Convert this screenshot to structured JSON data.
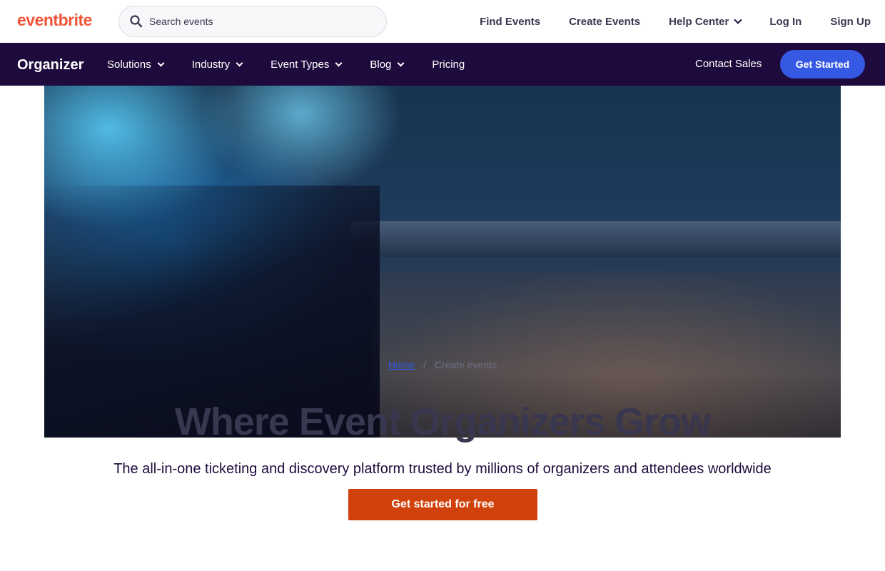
{
  "header": {
    "logo": "eventbrite",
    "search": {
      "placeholder": "Search events",
      "value": ""
    },
    "nav": [
      {
        "label": "Find Events",
        "dropdown": false
      },
      {
        "label": "Create Events",
        "dropdown": false
      },
      {
        "label": "Help Center",
        "dropdown": true
      },
      {
        "label": "Log In",
        "dropdown": false
      },
      {
        "label": "Sign Up",
        "dropdown": false
      }
    ]
  },
  "organizer_bar": {
    "title": "Organizer",
    "nav": [
      {
        "label": "Solutions",
        "dropdown": true
      },
      {
        "label": "Industry",
        "dropdown": true
      },
      {
        "label": "Event Types",
        "dropdown": true
      },
      {
        "label": "Blog",
        "dropdown": true
      },
      {
        "label": "Pricing",
        "dropdown": false
      }
    ],
    "contact_sales": "Contact Sales",
    "get_started": "Get Started"
  },
  "breadcrumb": {
    "home": "Home",
    "separator": "/",
    "current": "Create events"
  },
  "hero": {
    "title": "Where Event Organizers Grow",
    "subtitle": "The all-in-one ticketing and discovery platform trusted by millions of organizers and attendees worldwide",
    "cta": "Get started for free"
  },
  "colors": {
    "brand": "#f05537",
    "organizer_bar": "#1e0a3c",
    "get_started_button": "#3659e3",
    "cta_button": "#d1410c"
  }
}
